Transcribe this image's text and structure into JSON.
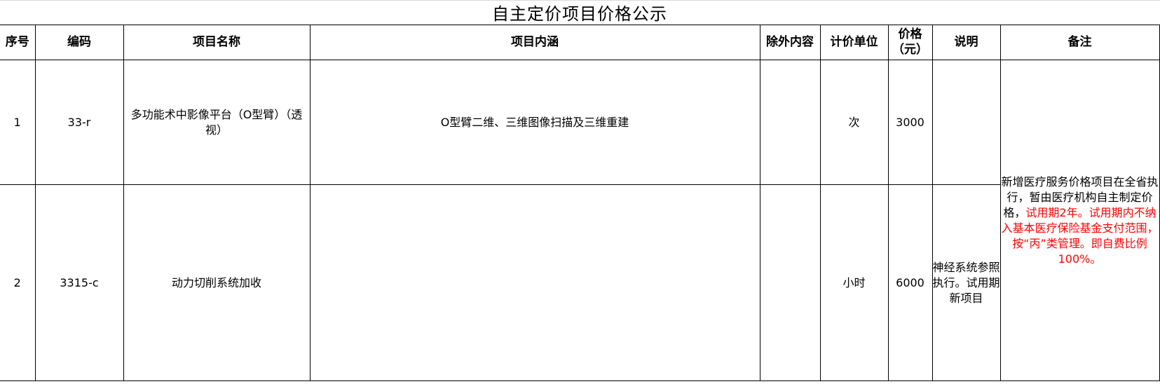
{
  "title": "自主定价项目价格公示",
  "columns": {
    "seq": "序号",
    "code": "编码",
    "name": "项目名称",
    "content": "项目内涵",
    "exclusion": "除外内容",
    "unit": "计价单位",
    "price": "价格（元）",
    "description": "说明",
    "remark": "备注"
  },
  "rows": [
    {
      "seq": "1",
      "code": "33-r",
      "name": "多功能术中影像平台（O型臂）（透视）",
      "content": "O型臂二维、三维图像扫描及三维重建",
      "exclusion": "",
      "unit": "次",
      "price": "3000",
      "description": ""
    },
    {
      "seq": "2",
      "code": "3315-c",
      "name": "动力切削系统加收",
      "content": "",
      "exclusion": "",
      "unit": "小时",
      "price": "6000",
      "description": "神经系统参照执行。试用期新项目"
    }
  ],
  "remark": {
    "black_part": "新增医疗服务价格项目在全省执行，暂由医疗机构自主制定价格，",
    "red_part": "试用期2年。试用期内不纳入基本医疗保险基金支付范围，按“丙”类管理。即自费比例100%。",
    "red_color": "#ff0000"
  }
}
